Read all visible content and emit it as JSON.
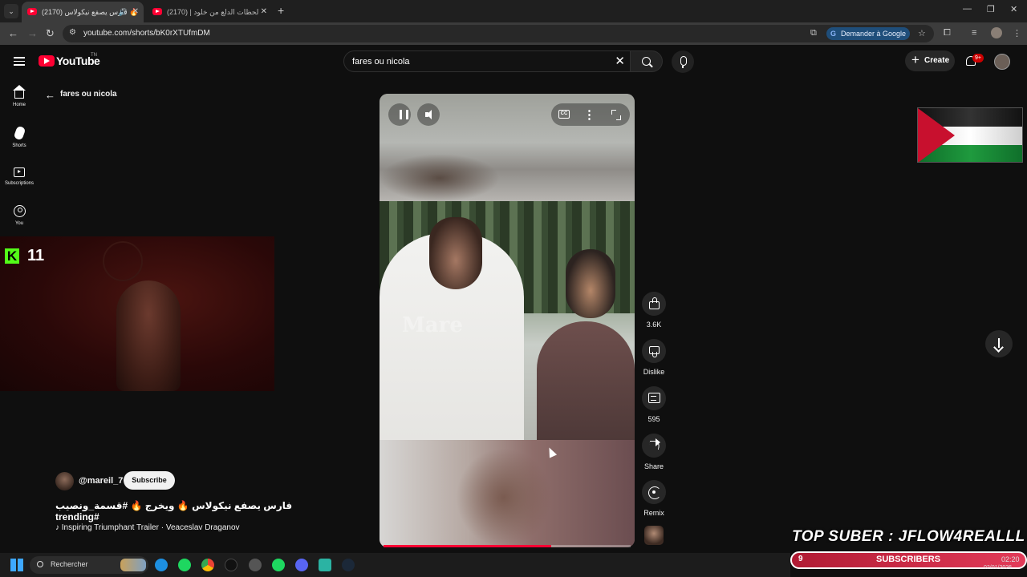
{
  "browser": {
    "tabs": [
      {
        "title": "(2170) فارس يصفع نيكولاس ‎🔥"
      },
      {
        "title": "(2170) لحظات الدلع من خلود | ال..."
      }
    ],
    "url": "youtube.com/shorts/bK0rXTUfmDM",
    "ask_google": "Demander à Google"
  },
  "header": {
    "logo_text": "YouTube",
    "region": "TN",
    "search_query": "fares ou nicola",
    "create_label": "Create",
    "notif_badge": "9+"
  },
  "sidebar": {
    "items": [
      {
        "label": "Home",
        "icon": "home-icon"
      },
      {
        "label": "Shorts",
        "icon": "shorts-icon"
      },
      {
        "label": "Subscriptions",
        "icon": "subscriptions-icon"
      },
      {
        "label": "You",
        "icon": "you-icon"
      }
    ]
  },
  "search_back": {
    "label": "fares ou nicola"
  },
  "overlay": {
    "counter_badge": "K",
    "counter_value": "11",
    "top_suber": "TOP SUBER : JFLOW4REALLL",
    "subs_count": "9",
    "subs_label": "SUBSCRIBERS",
    "flag": "palestine-flag"
  },
  "short": {
    "channel": "@mareil_7",
    "subscribe_label": "Subscribe",
    "title": "فارس يصفع نيكولاس 🔥 ويخرج 🔥 #قسمة_ونصيب #trending",
    "music": "♪ Inspiring Triumphant Trailer · Veaceslav Draganov",
    "watermark": "Mare",
    "progress": 0.68
  },
  "actions": {
    "likes": "3.6K",
    "dislike_label": "Dislike",
    "comments": "595",
    "share_label": "Share",
    "remix_label": "Remix"
  },
  "taskbar": {
    "search_placeholder": "Rechercher",
    "time": "02:20",
    "date": "02/01/2026"
  },
  "colors": {
    "yt_red": "#ff0033",
    "background": "#0f0f0f",
    "kick_green": "#53fc18"
  }
}
